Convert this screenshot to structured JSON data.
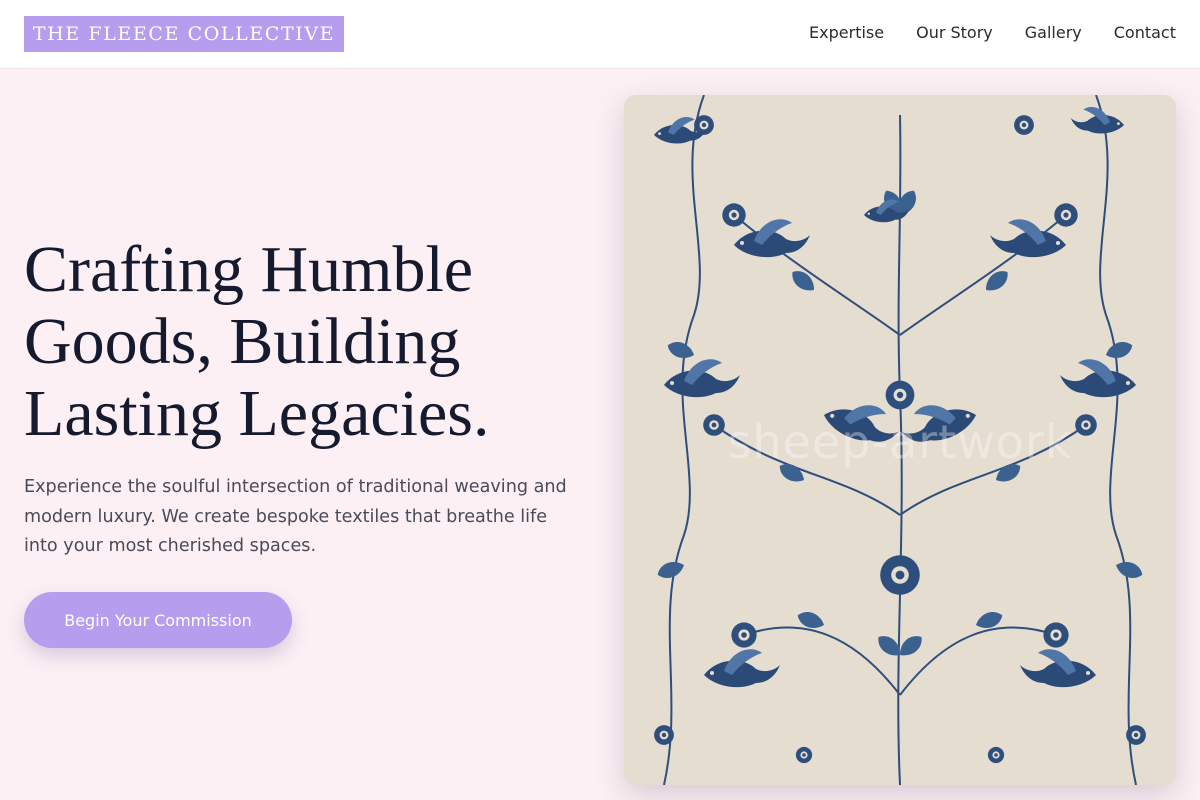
{
  "header": {
    "logo": "THE FLEECE COLLECTIVE",
    "nav": [
      "Expertise",
      "Our Story",
      "Gallery",
      "Contact"
    ]
  },
  "hero": {
    "title": "Crafting Humble Goods, Building Lasting Legacies.",
    "description": "Experience the soulful intersection of traditional weaving and modern luxury. We create bespoke textiles that breathe life into your most cherished spaces.",
    "cta": "Begin Your Commission"
  },
  "feature_image": {
    "subject": "blue floral toile textile with birds and vines",
    "watermark": "sheep-artwork"
  },
  "colors": {
    "accent": "#b79ded",
    "background": "#fcf0f4",
    "heading": "#151a2e",
    "ink_blue": "#2e4f7c",
    "fabric": "#e4ddd0"
  }
}
